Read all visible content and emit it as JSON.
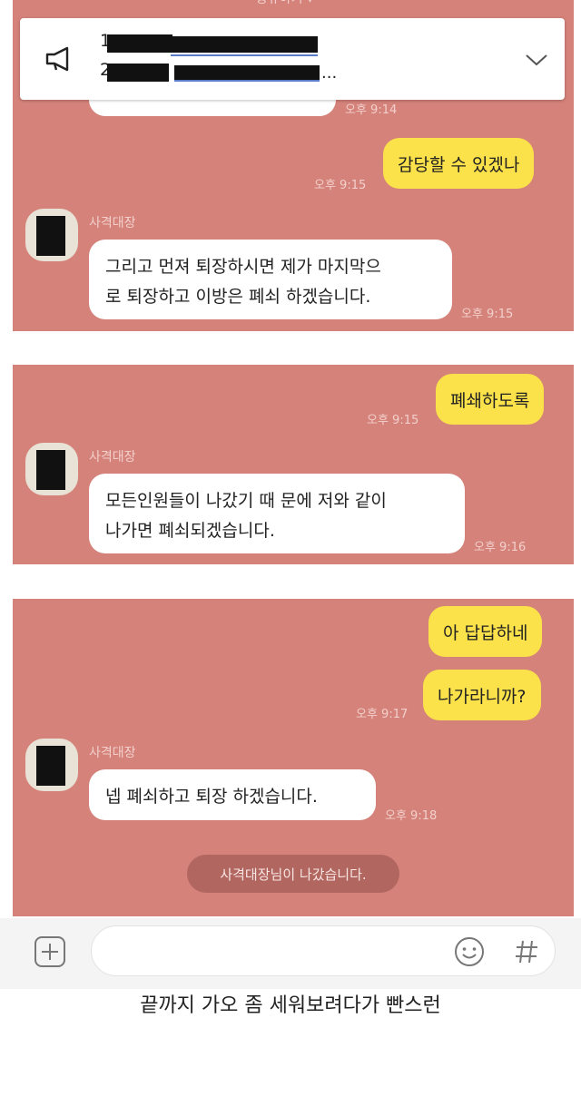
{
  "top_hint": "공유하기 ▾",
  "notice": {
    "line1_prefix": "1",
    "line2_prefix": "2",
    "line2_suffix": "..."
  },
  "panel1": {
    "time_top": "오후 9:14",
    "my_bubble": "감당할 수 있겠나",
    "my_time": "오후 9:15",
    "sender": "사격대장",
    "their_line1": "그리고 먼져 퇴장하시면 제가 마지막으",
    "their_line2": "로 퇴장하고 이방은 폐쇠 하겠습니다.",
    "their_time": "오후 9:15"
  },
  "panel2": {
    "my_bubble": "폐쇄하도록",
    "my_time": "오후 9:15",
    "sender": "사격대장",
    "their_line1": "모든인원들이 나갔기 때 문에  저와 같이",
    "their_line2": "나가면 폐쇠되겠습니다.",
    "their_time": "오후 9:16"
  },
  "panel3": {
    "my_bubble1": "아 답답하네",
    "my_bubble2": "나가라니까?",
    "my_time": "오후 9:17",
    "sender": "사격대장",
    "their_bubble": "넵 폐쇠하고 퇴장 하겠습니다.",
    "their_time": "오후 9:18",
    "system_msg": "사격대장님이 나갔습니다."
  },
  "input_bar": {
    "add_icon": "plus-square-icon",
    "emoji_icon": "smile-icon",
    "hash_icon": "hashtag-icon"
  },
  "caption": "끝까지 가오 좀 세워보려다가 빤스런",
  "colors": {
    "panel_bg": "#d4827a",
    "my_bubble": "#fbe14a",
    "their_bubble": "#ffffff"
  }
}
